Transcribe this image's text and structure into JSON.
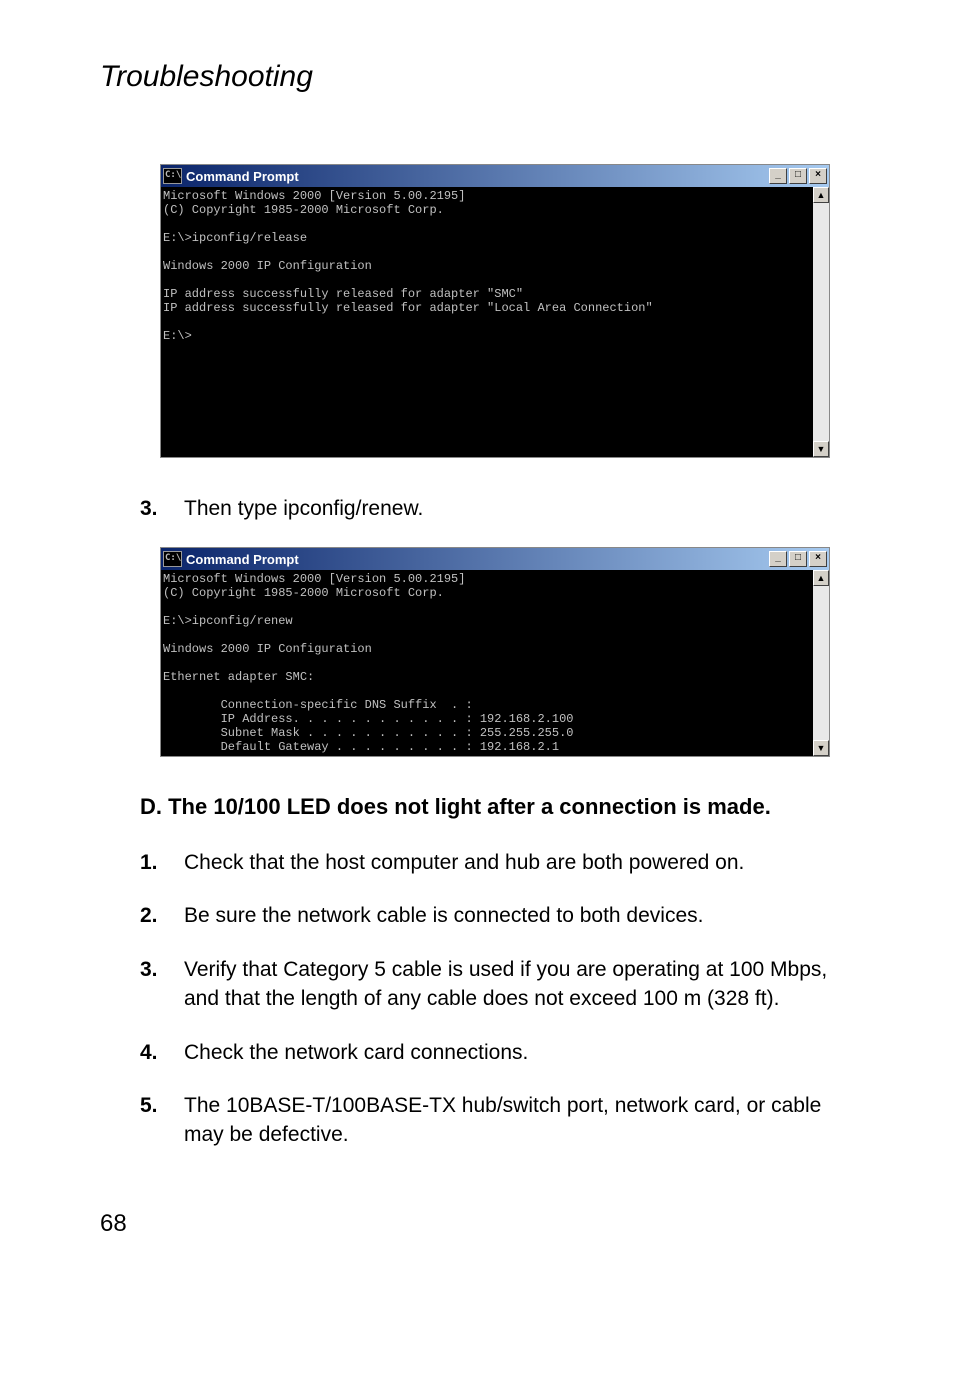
{
  "header": {
    "section_title": "Troubleshooting"
  },
  "cmd1": {
    "title": "Command Prompt",
    "body": "Microsoft Windows 2000 [Version 5.00.2195]\n(C) Copyright 1985-2000 Microsoft Corp.\n\nE:\\>ipconfig/release\n\nWindows 2000 IP Configuration\n\nIP address successfully released for adapter \"SMC\"\nIP address successfully released for adapter \"Local Area Connection\"\n\nE:\\>\n\n\n\n\n\n\n\n\n"
  },
  "step3": {
    "num": "3.",
    "text": "Then type ipconfig/renew."
  },
  "cmd2": {
    "title": "Command Prompt",
    "body": "Microsoft Windows 2000 [Version 5.00.2195]\n(C) Copyright 1985-2000 Microsoft Corp.\n\nE:\\>ipconfig/renew\n\nWindows 2000 IP Configuration\n\nEthernet adapter SMC:\n\n        Connection-specific DNS Suffix  . :\n        IP Address. . . . . . . . . . . . : 192.168.2.100\n        Subnet Mask . . . . . . . . . . . : 255.255.255.0\n        Default Gateway . . . . . . . . . : 192.168.2.1"
  },
  "section_d": {
    "heading": "D. The 10/100 LED does not light after a connection is made."
  },
  "d_steps": [
    {
      "num": "1.",
      "text": "Check that the host computer and hub are both powered on."
    },
    {
      "num": "2.",
      "text": "Be sure the network cable is connected to both devices."
    },
    {
      "num": "3.",
      "text": "Verify that Category 5 cable is used if you are operating at 100 Mbps, and that the length of any cable does not exceed 100 m (328 ft)."
    },
    {
      "num": "4.",
      "text": "Check the network card connections."
    },
    {
      "num": "5.",
      "text": "The 10BASE-T/100BASE-TX hub/switch port, network card, or cable may be defective."
    }
  ],
  "page_number": "68",
  "win_btns": {
    "min": "_",
    "max": "□",
    "close": "×",
    "up": "▲",
    "down": "▼"
  },
  "icon_glyph": "C:\\"
}
